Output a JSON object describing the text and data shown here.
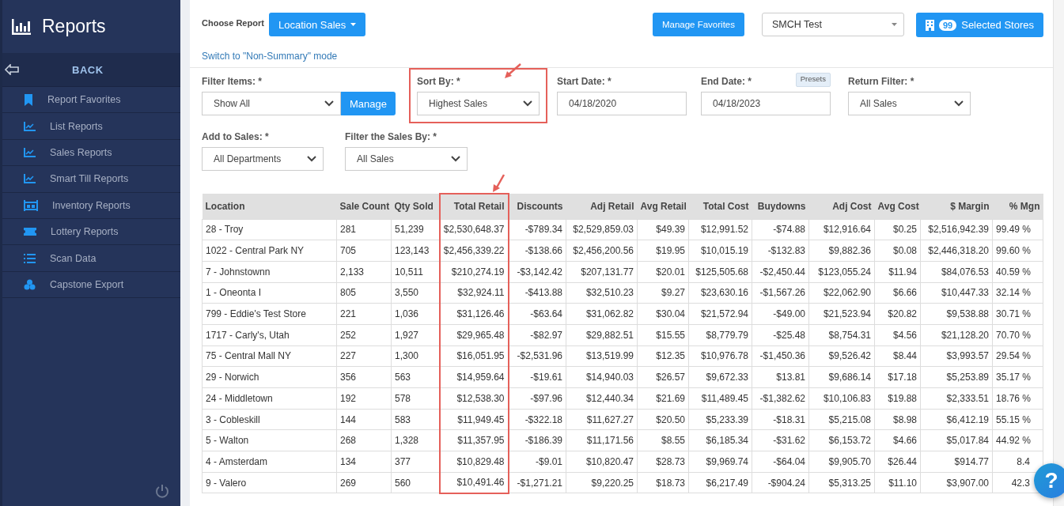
{
  "sidebar": {
    "title": "Reports",
    "back": "BACK",
    "items": [
      {
        "label": "Report Favorites"
      },
      {
        "label": "List Reports"
      },
      {
        "label": "Sales Reports"
      },
      {
        "label": "Smart Till Reports"
      },
      {
        "label": "Inventory Reports"
      },
      {
        "label": "Lottery Reports"
      },
      {
        "label": "Scan Data"
      },
      {
        "label": "Capstone Export"
      }
    ]
  },
  "header": {
    "choose_label": "Choose Report",
    "report_button": "Location Sales",
    "mode_link": "Switch to \"Non-Summary\" mode",
    "favorites_button": "Manage Favorites",
    "group_select": "SMCH Test",
    "stores_count": "99",
    "stores_button": "Selected Stores"
  },
  "filters": [
    {
      "kind": "select_manage",
      "label": "Filter Items: *",
      "value": "Show All",
      "button": "Manage",
      "highlighted": false
    },
    {
      "kind": "select",
      "label": "Sort By: *",
      "value": "Highest Sales",
      "highlighted": true
    },
    {
      "kind": "input",
      "label": "Start Date: *",
      "value": "04/18/2020",
      "highlighted": false
    },
    {
      "kind": "input_presets",
      "label": "End Date: *",
      "value": "04/18/2023",
      "button": "Presets",
      "highlighted": false
    },
    {
      "kind": "select",
      "label": "Return Filter: *",
      "value": "All Sales",
      "highlighted": false
    },
    {
      "kind": "select",
      "label": "Add to Sales: *",
      "value": "All Departments",
      "highlighted": false
    },
    {
      "kind": "select",
      "label": "Filter the Sales By: *",
      "value": "All Sales",
      "highlighted": false
    }
  ],
  "table": {
    "columns": [
      {
        "label": "Location",
        "highlighted": false
      },
      {
        "label": "Sale Count",
        "highlighted": false
      },
      {
        "label": "Qty Sold",
        "highlighted": false
      },
      {
        "label": "Total Retail",
        "highlighted": true
      },
      {
        "label": "Discounts",
        "highlighted": false
      },
      {
        "label": "Adj Retail",
        "highlighted": false
      },
      {
        "label": "Avg Retail",
        "highlighted": false
      },
      {
        "label": "Total Cost",
        "highlighted": false
      },
      {
        "label": "Buydowns",
        "highlighted": false
      },
      {
        "label": "Adj Cost",
        "highlighted": false
      },
      {
        "label": "Avg Cost",
        "highlighted": false
      },
      {
        "label": "$ Margin",
        "highlighted": false
      },
      {
        "label": "% Mgn",
        "highlighted": false
      }
    ],
    "rows": [
      [
        "28 - Troy",
        "281",
        "51,239",
        "$2,530,648.37",
        "-$789.34",
        "$2,529,859.03",
        "$49.39",
        "$12,991.52",
        "-$74.88",
        "$12,916.64",
        "$0.25",
        "$2,516,942.39",
        "99.49 %"
      ],
      [
        "1022 - Central Park NY",
        "705",
        "123,143",
        "$2,456,339.22",
        "-$138.66",
        "$2,456,200.56",
        "$19.95",
        "$10,015.19",
        "-$132.83",
        "$9,882.36",
        "$0.08",
        "$2,446,318.20",
        "99.60 %"
      ],
      [
        "7 - Johnstownn",
        "2,133",
        "10,511",
        "$210,274.19",
        "-$3,142.42",
        "$207,131.77",
        "$20.01",
        "$125,505.68",
        "-$2,450.44",
        "$123,055.24",
        "$11.94",
        "$84,076.53",
        "40.59 %"
      ],
      [
        "1 - Oneonta I",
        "805",
        "3,550",
        "$32,924.11",
        "-$413.88",
        "$32,510.23",
        "$9.27",
        "$23,630.16",
        "-$1,567.26",
        "$22,062.90",
        "$6.66",
        "$10,447.33",
        "32.14 %"
      ],
      [
        "799 - Eddie's Test Store",
        "221",
        "1,036",
        "$31,126.46",
        "-$63.64",
        "$31,062.82",
        "$30.04",
        "$21,572.94",
        "-$49.00",
        "$21,523.94",
        "$20.82",
        "$9,538.88",
        "30.71 %"
      ],
      [
        "1717 - Carly's, Utah",
        "252",
        "1,927",
        "$29,965.48",
        "-$82.97",
        "$29,882.51",
        "$15.55",
        "$8,779.79",
        "-$25.48",
        "$8,754.31",
        "$4.56",
        "$21,128.20",
        "70.70 %"
      ],
      [
        "75 - Central Mall NY",
        "227",
        "1,300",
        "$16,051.95",
        "-$2,531.96",
        "$13,519.99",
        "$12.35",
        "$10,976.78",
        "-$1,450.36",
        "$9,526.42",
        "$8.44",
        "$3,993.57",
        "29.54 %"
      ],
      [
        "29 - Norwich",
        "356",
        "563",
        "$14,959.64",
        "-$19.61",
        "$14,940.03",
        "$26.57",
        "$9,672.33",
        "$13.81",
        "$9,686.14",
        "$17.18",
        "$5,253.89",
        "35.17 %"
      ],
      [
        "24 - Middletown",
        "192",
        "578",
        "$12,538.30",
        "-$97.96",
        "$12,440.34",
        "$21.69",
        "$11,489.45",
        "-$1,382.62",
        "$10,106.83",
        "$19.88",
        "$2,333.51",
        "18.76 %"
      ],
      [
        "3 - Cobleskill",
        "144",
        "583",
        "$11,949.45",
        "-$322.18",
        "$11,627.27",
        "$20.50",
        "$5,233.39",
        "-$18.31",
        "$5,215.08",
        "$8.98",
        "$6,412.19",
        "55.15 %"
      ],
      [
        "5 - Walton",
        "268",
        "1,328",
        "$11,357.95",
        "-$186.39",
        "$11,171.56",
        "$8.55",
        "$6,185.34",
        "-$31.62",
        "$6,153.72",
        "$4.66",
        "$5,017.84",
        "44.92 %"
      ],
      [
        "4 - Amsterdam",
        "134",
        "377",
        "$10,829.48",
        "-$9.01",
        "$10,820.47",
        "$28.73",
        "$9,969.74",
        "-$64.04",
        "$9,905.70",
        "$26.44",
        "$914.77",
        "8.4"
      ],
      [
        "9 - Valero",
        "269",
        "560",
        "$10,491.46",
        "-$1,271.21",
        "$9,220.25",
        "$18.73",
        "$6,217.49",
        "-$904.24",
        "$5,313.25",
        "$11.10",
        "$3,907.00",
        "42.3"
      ]
    ]
  },
  "help_button": "?"
}
